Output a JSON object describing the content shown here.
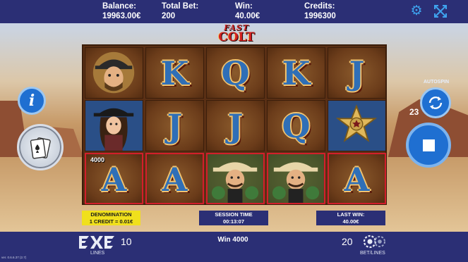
{
  "topbar": {
    "balance_label": "Balance:",
    "balance_value": "19963.00€",
    "total_bet_label": "Total Bet:",
    "total_bet_value": "200",
    "win_label": "Win:",
    "win_value": "40.00€",
    "credits_label": "Credits:",
    "credits_value": "1996300",
    "settings_icon": "gear-icon",
    "fullscreen_icon": "fullscreen-icon"
  },
  "logo": {
    "line1": "FAST",
    "line2": "COLT"
  },
  "reels": [
    [
      "outlaw",
      "cowgirl",
      "A"
    ],
    [
      "K",
      "J",
      "A"
    ],
    [
      "Q",
      "J",
      "gunslinger"
    ],
    [
      "K",
      "Q",
      "gunslinger"
    ],
    [
      "J",
      "sheriff-star",
      "A"
    ]
  ],
  "winning_line": {
    "amount": "4000",
    "cells": [
      "r0c2",
      "r1c2",
      "r2c2",
      "r3c2",
      "r4c2"
    ]
  },
  "side": {
    "info_label": "i",
    "autospin_label": "AUTOSPIN",
    "autospin_count": "23"
  },
  "panels": {
    "denomination_label": "DENOMINATION",
    "denomination_value": "1 CREDIT = 0.01€",
    "session_label": "SESSION TIME",
    "session_value": "00:13:07",
    "last_win_label": "LAST WIN:",
    "last_win_value": "40.00€"
  },
  "bottombar": {
    "lines_label": "LINES",
    "lines_value": "10",
    "win_text": "Win 4000",
    "bet_value": "20",
    "bet_label": "BET/LINES",
    "version": "ver. 0.6.6.37 (2.7)"
  },
  "colors": {
    "bar": "#2b2f75",
    "accent_blue": "#1f6fd1",
    "win_border": "#d21f2b",
    "denom_yellow": "#f0e01c"
  }
}
